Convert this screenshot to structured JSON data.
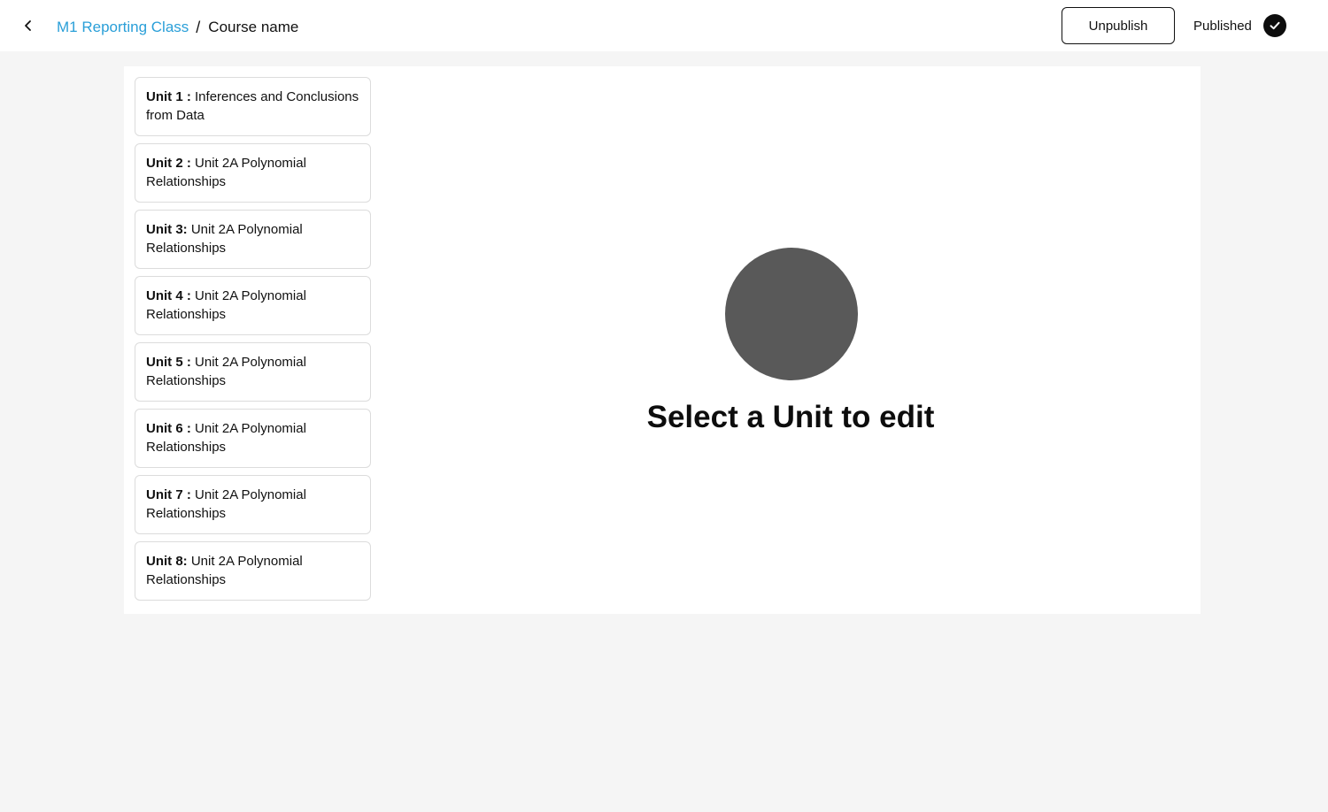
{
  "header": {
    "breadcrumb_parent": "M1 Reporting Class",
    "breadcrumb_separator": "/",
    "breadcrumb_current": "Course name",
    "unpublish_label": "Unpublish",
    "status_label": "Published"
  },
  "units": [
    {
      "num": "Unit 1 :",
      "title": "Inferences and Conclusions from Data"
    },
    {
      "num": "Unit 2 :",
      "title": "Unit 2A Polynomial Relationships"
    },
    {
      "num": "Unit 3:",
      "title": "Unit 2A Polynomial Relationships"
    },
    {
      "num": "Unit 4 :",
      "title": "Unit 2A Polynomial Relationships"
    },
    {
      "num": "Unit 5 :",
      "title": "Unit 2A Polynomial Relationships"
    },
    {
      "num": "Unit 6 :",
      "title": "Unit 2A Polynomial Relationships"
    },
    {
      "num": "Unit 7 :",
      "title": "Unit 2A Polynomial Relationships"
    },
    {
      "num": "Unit 8:",
      "title": "Unit 2A Polynomial Relationships"
    }
  ],
  "empty_state": {
    "title": "Select a Unit to edit"
  },
  "colors": {
    "link": "#2a9fd8",
    "background": "#f5f5f5",
    "placeholder": "#595959"
  },
  "icons": {
    "back": "chevron-left-icon",
    "status": "check-circle-icon"
  }
}
